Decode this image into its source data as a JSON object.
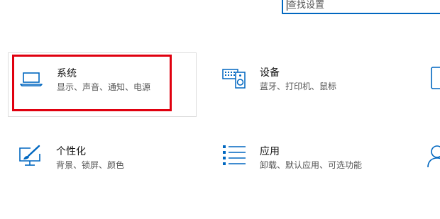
{
  "search": {
    "placeholder": "查找设置"
  },
  "tiles": {
    "system": {
      "title": "系统",
      "desc": "显示、声音、通知、电源",
      "icon": "laptop-icon"
    },
    "devices": {
      "title": "设备",
      "desc": "蓝牙、打印机、鼠标",
      "icon": "keyboard-speaker-icon"
    },
    "phone": {
      "icon": "phone-icon"
    },
    "personalization": {
      "title": "个性化",
      "desc": "背景、锁屏、颜色",
      "icon": "paintbrush-monitor-icon"
    },
    "apps": {
      "title": "应用",
      "desc": "卸载、默认应用、可选功能",
      "icon": "apps-list-icon"
    },
    "accounts": {
      "icon": "person-icon"
    }
  },
  "colors": {
    "accent": "#0067c0",
    "highlight": "#e0000f",
    "tile_border": "#dcdcdc"
  }
}
